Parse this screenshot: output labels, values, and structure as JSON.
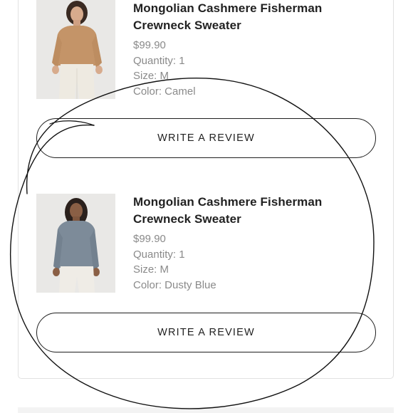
{
  "items": [
    {
      "title_line1": "Mongolian Cashmere Fisherman",
      "title_line2": "Crewneck Sweater",
      "price": "$99.90",
      "quantity": "Quantity: 1",
      "size": "Size: M",
      "color": "Color: Camel",
      "swatch": "#c49468",
      "review_label": "WRITE A REVIEW"
    },
    {
      "title_line1": "Mongolian Cashmere Fisherman",
      "title_line2": "Crewneck Sweater",
      "price": "$99.90",
      "quantity": "Quantity: 1",
      "size": "Size: M",
      "color": "Color: Dusty Blue",
      "swatch": "#7d8b99",
      "review_label": "WRITE A REVIEW"
    }
  ],
  "colors": {
    "text_primary": "#222222",
    "text_secondary": "#8a8a8a",
    "border": "#1f1f1f",
    "scribble": "#111111"
  }
}
